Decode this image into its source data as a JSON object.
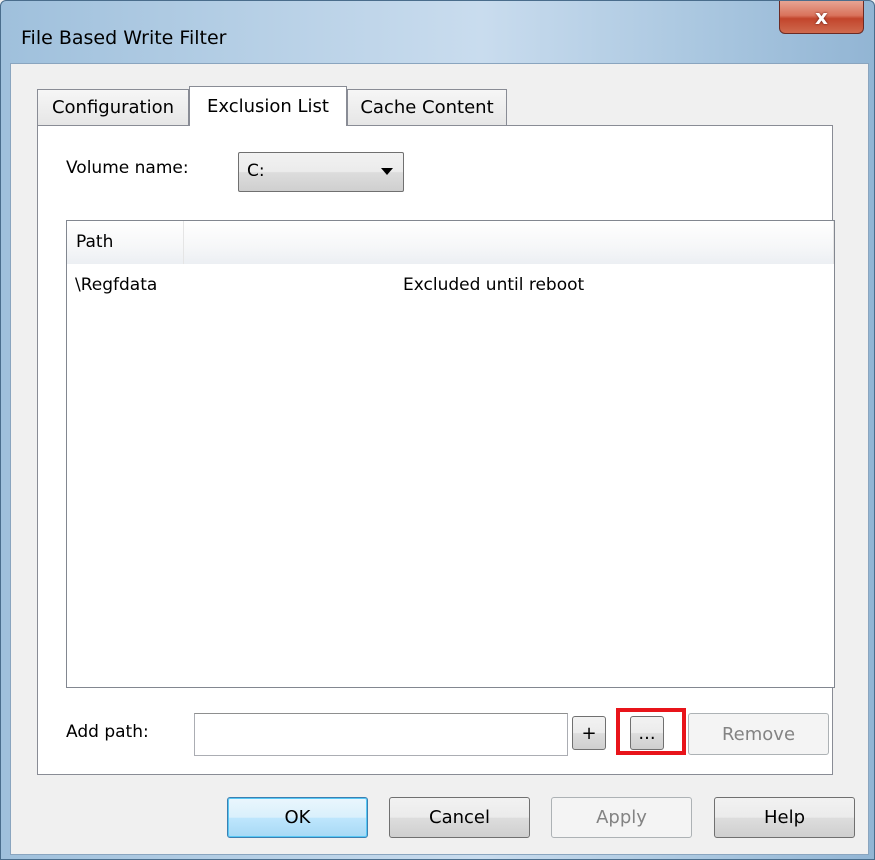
{
  "window": {
    "title": "File Based Write Filter",
    "close_glyph": "x"
  },
  "tabs": [
    {
      "label": "Configuration",
      "active": false
    },
    {
      "label": "Exclusion List",
      "active": true
    },
    {
      "label": "Cache Content",
      "active": false
    }
  ],
  "volume": {
    "label": "Volume name:",
    "selected": "C:"
  },
  "exclusions": {
    "columns": [
      "Path",
      ""
    ],
    "rows": [
      {
        "path": "\\Regfdata",
        "status": "Excluded until reboot"
      }
    ]
  },
  "add_path": {
    "label": "Add path:",
    "value": "",
    "add_button": "+",
    "browse_button": "...",
    "remove_button": "Remove"
  },
  "footer": {
    "ok": "OK",
    "cancel": "Cancel",
    "apply": "Apply",
    "help": "Help"
  },
  "colors": {
    "highlight": "#e8141a",
    "close_button": "#c2452c"
  }
}
